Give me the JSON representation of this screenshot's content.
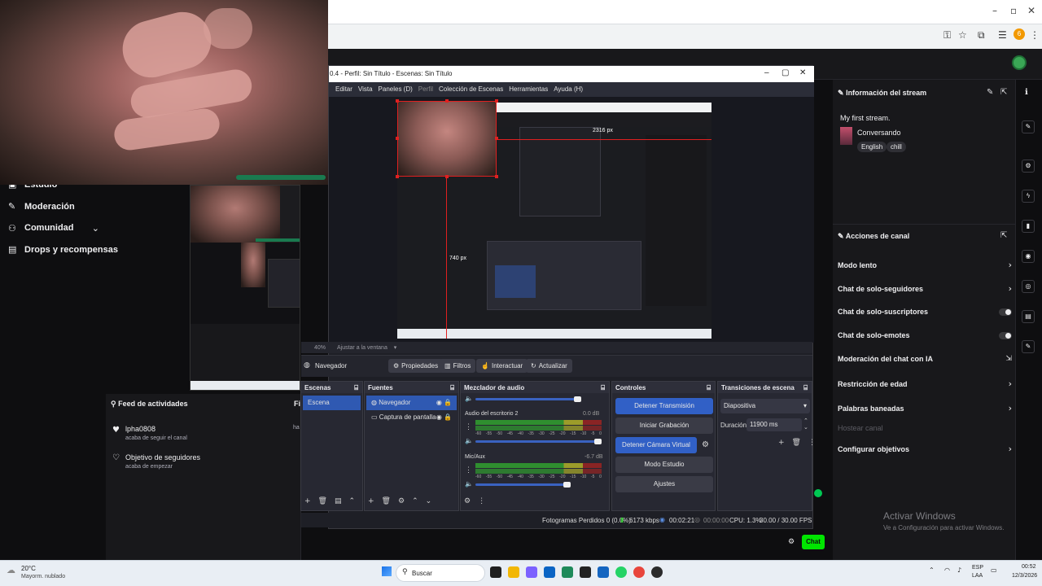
{
  "browser": {
    "minimize": "–",
    "restore": "▫",
    "close": "✕",
    "ext_badge": "6"
  },
  "webcam": {},
  "left_nav": {
    "items": [
      {
        "label": "Estudio",
        "icon": "studio-icon"
      },
      {
        "label": "Moderación",
        "icon": "wrench-icon"
      },
      {
        "label": "Comunidad",
        "icon": "community-icon"
      },
      {
        "label": "Drops y recompensas",
        "icon": "drops-icon"
      }
    ]
  },
  "activity_feed": {
    "title": "Feed de actividades",
    "side_letter": "Fi",
    "events": [
      {
        "name": "lpha0808",
        "sub": "acaba de seguir el canal",
        "time": "ha"
      },
      {
        "name": "Objetivo de seguidores",
        "sub": "acaba de empezar"
      }
    ]
  },
  "obs": {
    "title": "0.4 - Perfil: Sin Título - Escenas: Sin Título",
    "menu": [
      "Editar",
      "Vista",
      "Paneles (D)",
      "Perfil",
      "Colección de Escenas",
      "Herramientas",
      "Ayuda (H)"
    ],
    "preview_labels": {
      "top": "2316 px",
      "left": "740 px"
    },
    "zoom": {
      "value": "40%",
      "fit": "Ajustar a la ventana"
    },
    "source_bar": {
      "selected_source": "Navegador",
      "buttons": [
        "Propiedades",
        "Filtros",
        "Interactuar",
        "Actualizar"
      ]
    },
    "docks": {
      "scenes": {
        "title": "Escenas",
        "items": [
          "Escena"
        ]
      },
      "sources": {
        "title": "Fuentes",
        "items": [
          "Navegador",
          "Captura de pantalla"
        ]
      },
      "mixer": {
        "title": "Mezclador de audio",
        "channels": [
          {
            "name": "Audio del escritorio 2",
            "db": "0.0 dB",
            "level": 0.9
          },
          {
            "name": "Mic/Aux",
            "db": "-6.7 dB",
            "level": 0.55
          }
        ],
        "ticks": [
          "-60",
          "-55",
          "-50",
          "-45",
          "-40",
          "-35",
          "-30",
          "-25",
          "-20",
          "-15",
          "-10",
          "-5",
          "0"
        ]
      },
      "controls": {
        "title": "Controles",
        "buttons": [
          "Detener Transmisión",
          "Iniciar Grabación",
          "Detener Cámara Virtual",
          "Modo Estudio",
          "Ajustes"
        ]
      },
      "transitions": {
        "title": "Transiciones de escena",
        "selected": "Diapositiva",
        "duration_label": "Duración",
        "duration_value": "11900 ms"
      }
    },
    "status": {
      "frames": "Fotogramas Perdidos 0 (0.0%)",
      "bitrate": "6173 kbps",
      "stream_time": "00:02:21",
      "rec_time": "00:00:00",
      "cpu": "CPU: 1.3%",
      "fps": "30.00 / 30.00 FPS"
    }
  },
  "right_panel": {
    "stream_info": {
      "title": "Información del stream",
      "stream_title": "My first stream.",
      "category": "Conversando",
      "tags": [
        "English",
        "chill"
      ]
    },
    "channel_actions": {
      "title": "Acciones de canal",
      "items": [
        {
          "label": "Modo lento",
          "control": "chevron"
        },
        {
          "label": "Chat de solo-seguidores",
          "control": "chevron"
        },
        {
          "label": "Chat de solo-suscriptores",
          "control": "toggle"
        },
        {
          "label": "Chat de solo-emotes",
          "control": "toggle"
        },
        {
          "label": "Moderación del chat con IA",
          "control": "external"
        },
        {
          "label": "Restricción de edad",
          "control": "chevron"
        },
        {
          "label": "Palabras baneadas",
          "control": "chevron"
        },
        {
          "label": "Hostear canal",
          "control": "none",
          "disabled": true
        },
        {
          "label": "Configurar objetivos",
          "control": "chevron"
        }
      ]
    },
    "chat_button": "Chat"
  },
  "windows_activation": {
    "line1": "Activar Windows",
    "line2": "Ve a Configuración para activar Windows."
  },
  "taskbar": {
    "weather_temp": "20°C",
    "weather_desc": "Mayorm. nublado",
    "search": "Buscar",
    "lang": "ESP",
    "lang2": "LAA",
    "time": "00:52",
    "date": "12/3/2026"
  },
  "colors": {
    "twitch_bg": "#0e0e10",
    "obs_blue": "#3160c6",
    "selection_red": "#e02020",
    "chat_green": "#00e500"
  }
}
